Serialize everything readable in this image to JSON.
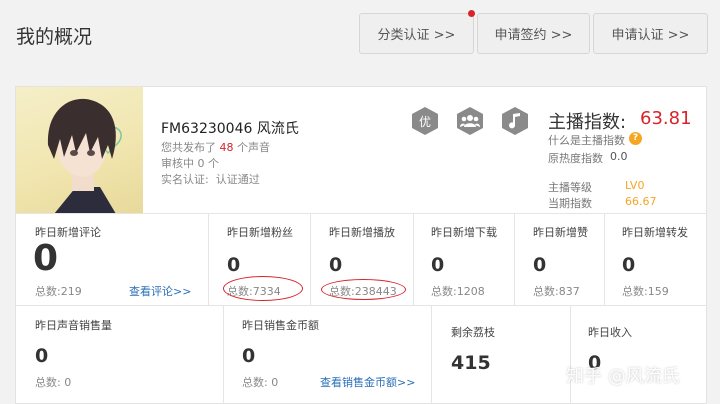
{
  "page_title": "我的概况",
  "top_buttons": [
    "分类认证 >>",
    "申请签约 >>",
    "申请认证 >>"
  ],
  "profile": {
    "name": "FM63230046 风流氏",
    "published_prefix": "您共发布了",
    "published_count": "48",
    "published_suffix": "个声音",
    "review": "审核中 0 个",
    "verify_label": "实名认证:",
    "verify_value": "认证通过"
  },
  "badges": [
    {
      "label": "优",
      "icon": "quality-badge-icon"
    },
    {
      "label": "",
      "icon": "group-badge-icon"
    },
    {
      "label": "",
      "icon": "music-note-icon"
    }
  ],
  "anchor_index": {
    "title": "主播指数:",
    "value": "63.81",
    "what_is": "什么是主播指数",
    "help": "?",
    "heat_label": "原热度指数",
    "heat_value": "0.0",
    "level_label": "主播等级",
    "level_value": "LV0",
    "current_label": "当期指数",
    "current_value": "66.67"
  },
  "stats_row1": [
    {
      "label": "昨日新增评论",
      "value": "0",
      "total": "总数:219",
      "link": "查看评论>>"
    },
    {
      "label": "昨日新增粉丝",
      "value": "0",
      "total": "总数:7334"
    },
    {
      "label": "昨日新增播放",
      "value": "0",
      "total": "总数:238443"
    },
    {
      "label": "昨日新增下载",
      "value": "0",
      "total": "总数:1208"
    },
    {
      "label": "昨日新增赞",
      "value": "0",
      "total": "总数:837"
    },
    {
      "label": "昨日新增转发",
      "value": "0",
      "total": "总数:159"
    }
  ],
  "stats_row2": [
    {
      "label": "昨日声音销售量",
      "value": "0",
      "total": "总数: 0"
    },
    {
      "label": "昨日销售金币额",
      "value": "0",
      "total": "总数: 0",
      "link": "查看销售金币额>>"
    },
    {
      "label": "剩余荔枝",
      "value": "415"
    },
    {
      "label": "昨日收入",
      "value": "0"
    }
  ],
  "watermark": "知乎 @风流氏",
  "colors": {
    "accent_red": "#d8232a",
    "orange": "#f5a623",
    "link_blue": "#2a6fb8"
  }
}
